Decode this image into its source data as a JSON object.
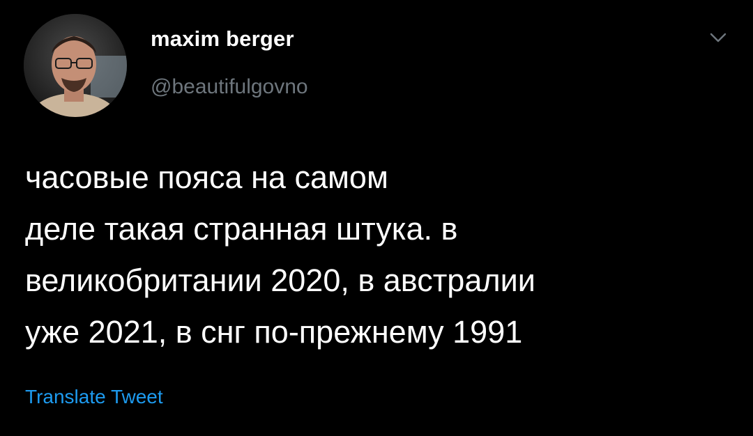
{
  "tweet": {
    "author": {
      "display_name": "maxim berger",
      "handle": "@beautifulgovno",
      "avatar_icon": "user-avatar-photo"
    },
    "menu_icon": "chevron-down-icon",
    "text_lines": [
      "часовые пояса на самом",
      "деле такая странная штука. в",
      "великобритании 2020, в австралии",
      "уже 2021, в снг по-прежнему 1991"
    ],
    "translate_label": "Translate Tweet"
  },
  "colors": {
    "background": "#000000",
    "text": "#ffffff",
    "secondary_text": "#6e767d",
    "link": "#1d9bf0"
  }
}
